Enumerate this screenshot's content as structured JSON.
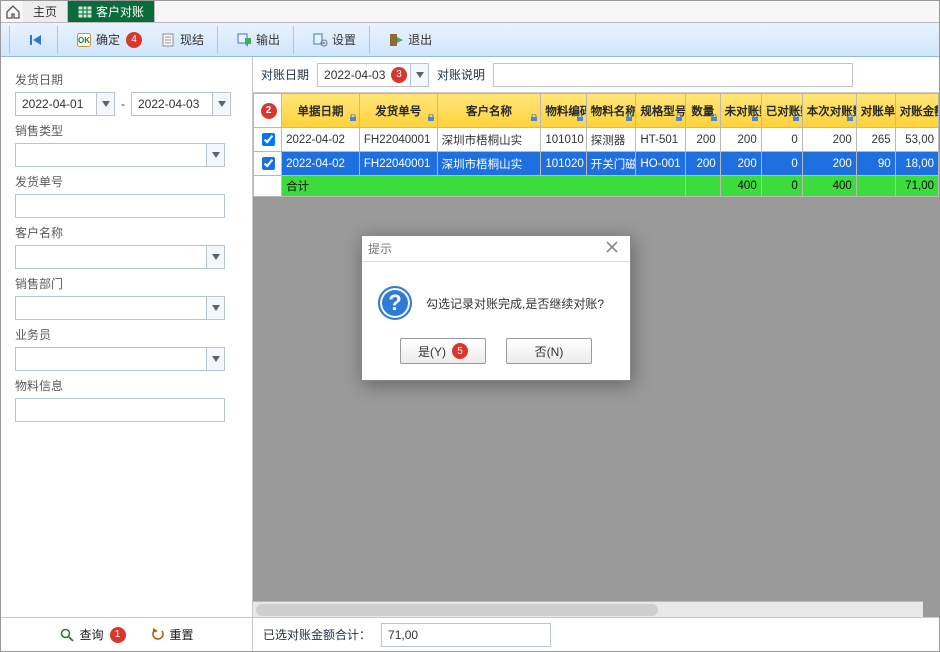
{
  "tabs": {
    "home": "主页",
    "active": "客户对账"
  },
  "toolbar": {
    "first": "",
    "confirm": "确定",
    "confirm_badge": "4",
    "settle": "现结",
    "export": "输出",
    "settings": "设置",
    "exit": "退出"
  },
  "filters": {
    "ship_date_label": "发货日期",
    "ship_date_from": "2022-04-01",
    "ship_date_sep": "-",
    "ship_date_to": "2022-04-03",
    "sale_type_label": "销售类型",
    "sale_type_value": "",
    "ship_no_label": "发货单号",
    "ship_no_value": "",
    "customer_label": "客户名称",
    "customer_value": "",
    "dept_label": "销售部门",
    "dept_value": "",
    "salesman_label": "业务员",
    "salesman_value": "",
    "material_label": "物料信息",
    "material_value": "",
    "query": "查询",
    "query_badge": "1",
    "reset": "重置"
  },
  "header": {
    "recon_date_label": "对账日期",
    "recon_date": "2022-04-03",
    "recon_date_badge": "3",
    "recon_desc_label": "对账说明",
    "recon_desc_value": ""
  },
  "columns": {
    "badge": "2",
    "c1": "单据日期",
    "c2": "发货单号",
    "c3": "客户名称",
    "c4": "物料编码",
    "c5": "物料名称",
    "c6": "规格型号",
    "c7": "数量",
    "c8": "未对账数",
    "c9": "已对账数",
    "c10": "本次对账数量",
    "c11": "对账单价",
    "c12": "对账金额"
  },
  "rows": [
    {
      "checked": true,
      "date": "2022-04-02",
      "ship_no": "FH22040001",
      "cust": "深圳市梧桐山实",
      "matc": "101010",
      "matn": "探测器",
      "spec": "HT-501",
      "qty": "200",
      "unrec": "200",
      "rec": "0",
      "thisrec": "200",
      "price": "265",
      "amount": "53,00"
    },
    {
      "checked": true,
      "date": "2022-04-02",
      "ship_no": "FH22040001",
      "cust": "深圳市梧桐山实",
      "matc": "101020",
      "matn": "开关门磁",
      "spec": "HO-001",
      "qty": "200",
      "unrec": "200",
      "rec": "0",
      "thisrec": "200",
      "price": "90",
      "amount": "18,00"
    }
  ],
  "sum": {
    "label": "合计",
    "qty": "",
    "unrec": "400",
    "rec": "0",
    "thisrec": "400",
    "price": "",
    "amount": "71,00"
  },
  "footer": {
    "total_label": "已选对账金额合计：",
    "total_value": "71,00"
  },
  "dialog": {
    "title": "提示",
    "message": "勾选记录对账完成,是否继续对账?",
    "yes": "是(Y)",
    "yes_badge": "5",
    "no": "否(N)"
  }
}
